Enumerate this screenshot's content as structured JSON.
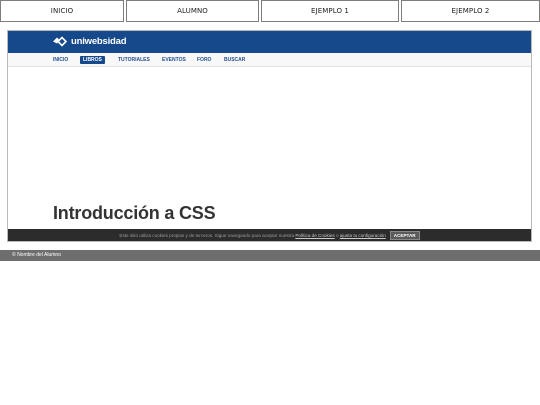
{
  "top_nav": {
    "items": [
      {
        "label": "INICIO"
      },
      {
        "label": "ALUMNO"
      },
      {
        "label": "EJEMPLO 1"
      },
      {
        "label": "EJEMPLO 2"
      }
    ]
  },
  "site": {
    "logo_text": "uniwebsidad",
    "nav": [
      {
        "label": "INICIO"
      },
      {
        "label": "LIBROS",
        "active": true
      },
      {
        "label": "TUTORIALES"
      },
      {
        "label": "EVENTOS"
      },
      {
        "label": "FORO"
      },
      {
        "label": "BUSCAR"
      }
    ],
    "heading": "Introducción a CSS",
    "colors": {
      "header": "#16488c",
      "link": "#1f4e94"
    }
  },
  "cookie_bar": {
    "text": "Este sitio utiliza cookies propias y de terceros. Sigue navegando para aceptar nuestra",
    "policy_link": "Política de Cookies",
    "connector": "o",
    "config_link": "ajusta tu configuración",
    "button": "ACEPTAR"
  },
  "footer": {
    "text": "© Nombre del Alumno"
  }
}
